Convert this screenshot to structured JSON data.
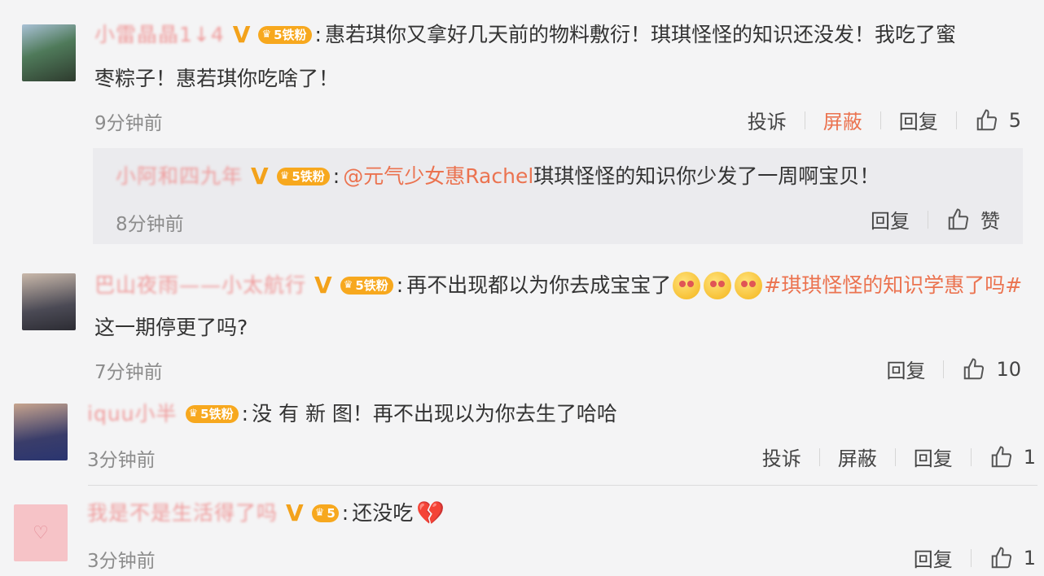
{
  "comments": [
    {
      "user": "小雷晶晶1↓4",
      "fan_label": "铁粉",
      "fan_level": "5",
      "text": "惠若琪你又拿好几天前的物料敷衍！琪琪怪怪的知识还没发！我吃了蜜",
      "text2": "枣粽子！惠若琪你吃啥了！",
      "time": "9分钟前",
      "actions": {
        "report": "投诉",
        "block": "屏蔽",
        "reply": "回复",
        "like_count": "5"
      }
    },
    {
      "user": "小阿和四九年",
      "fan_label": "铁粉",
      "fan_level": "5",
      "mention": "@元气少女惠Rachel",
      "text": " 琪琪怪怪的知识你少发了一周啊宝贝！",
      "time": "8分钟前",
      "actions": {
        "reply": "回复",
        "like": "赞"
      }
    },
    {
      "user": "巴山夜雨——小太航行",
      "fan_label": "铁粉",
      "fan_level": "5",
      "text": "再不出现都以为你去成宝宝了",
      "tag": "#琪琪怪怪的知识学惠了吗#",
      "text2": "这一期停更了吗?",
      "time": "7分钟前",
      "actions": {
        "reply": "回复",
        "like_count": "10"
      }
    },
    {
      "user": "iquu小半",
      "fan_label": "铁粉",
      "fan_level": "5",
      "text": "没 有 新 图！再不出现以为你去生了哈哈",
      "time": "3分钟前",
      "actions": {
        "report": "投诉",
        "block": "屏蔽",
        "reply": "回复",
        "like_count": "1"
      }
    },
    {
      "user": "我是不是生活得了吗",
      "fan_level": "5",
      "text": "还没吃",
      "time": "3分钟前",
      "actions": {
        "reply": "回复",
        "like_count": "1"
      }
    }
  ],
  "colors": {
    "accent": "#eb7350",
    "fan_badge": "#f7a81e",
    "verified": "#f3a21b"
  },
  "icons": [
    "verified-v-icon",
    "fan-crown-icon",
    "thumbs-up-icon",
    "heart-broken-icon",
    "emoji-icon"
  ]
}
